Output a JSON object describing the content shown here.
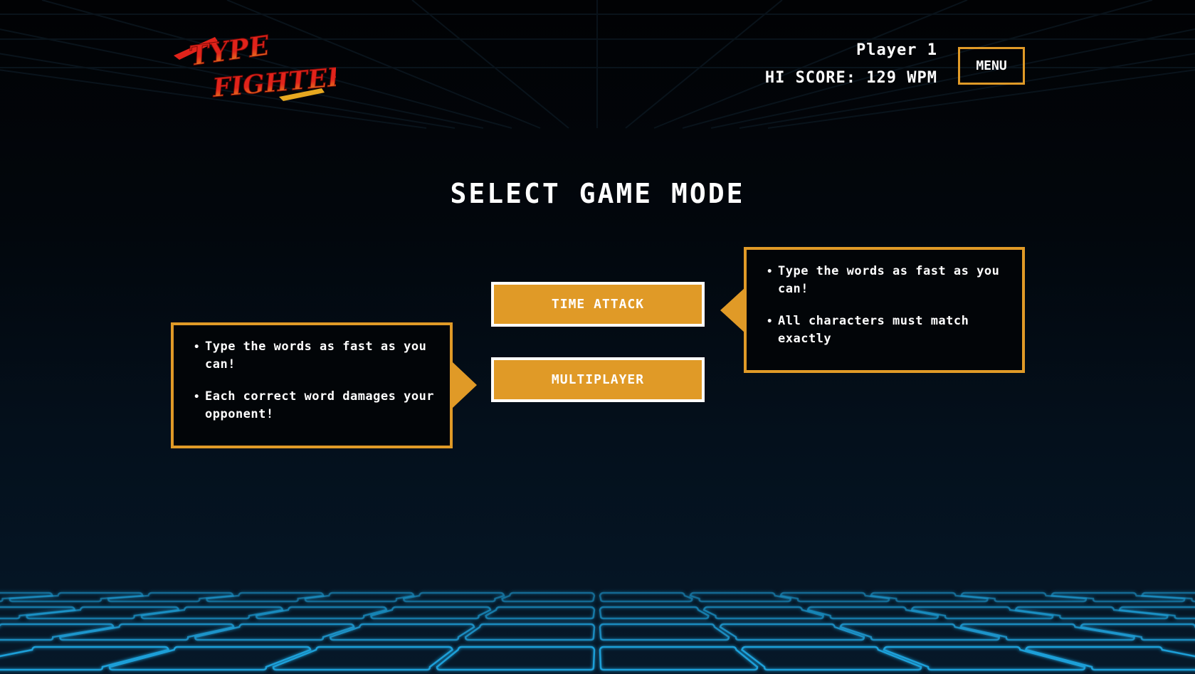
{
  "logo": {
    "line1": "TYPE",
    "line2": "FIGHTER"
  },
  "header": {
    "player": "Player 1",
    "hi_score": "HI SCORE: 129 WPM",
    "menu_label": "MENU"
  },
  "main": {
    "title": "SELECT GAME MODE",
    "modes": [
      {
        "label": "TIME ATTACK",
        "tips": [
          "Type the words as fast as you can!",
          "All characters must match exactly"
        ]
      },
      {
        "label": "MULTIPLAYER",
        "tips": [
          "Type the words as fast as you can!",
          "Each correct word damages your opponent!"
        ]
      }
    ]
  },
  "colors": {
    "accent": "#e09a27",
    "grid": "#1e9fd8",
    "background": "#02070d",
    "logo_red": "#e0231b",
    "logo_gold": "#e6a820"
  }
}
